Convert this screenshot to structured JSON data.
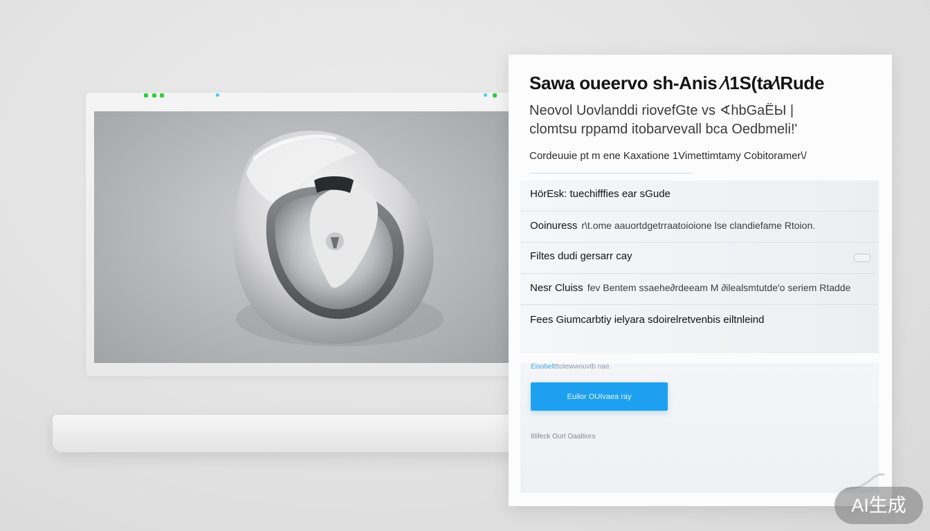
{
  "panel": {
    "title": "Sawa ouеervo sh-Anis  ⁄\\1S(ta⁄\\Rude",
    "subtitle_line1": "Neovol  Uovlanddi  riovefGte vs  ∢hbGaЁЫ  |",
    "subtitle_line2": "clomtsu rppamd  itobarvevall  bca  Oedbmeli!'",
    "hint": "Cordeuuie pt m ene  Kaxatione 1Vimettimtamy Cobitoramer\\/",
    "rows": [
      {
        "lead": "HörEsk: tuechifffies ear sGude",
        "rest": ""
      },
      {
        "lead": "Ooinuress",
        "rest": "r\\t.ome aauortdgetrraatoioione lse clandiefame Rtoion."
      },
      {
        "lead": "Filtes dudi gersarr cay",
        "rest": ""
      },
      {
        "lead": "Nesr Cluiss",
        "rest": "fev  Bentem ssaehe∂rdeeam M ∂ilealsmtutde'o seriem Rtadde"
      },
      {
        "lead": "Fees  Giumcarbtiy ielyara sdoirelretvenbis eiltnleind",
        "rest": ""
      }
    ],
    "link_blue": "Eisobelt",
    "link_gray": "ttotewwnuvtb nae.",
    "button_label": "Euilor  OUIvaea ray",
    "footer_link": "Iltifeck Ourt Oaaltiors"
  },
  "laptop": {
    "status_dots": [
      "green",
      "green",
      "green",
      "cyan",
      "cyan",
      "green"
    ]
  },
  "watermark": "AI生成"
}
